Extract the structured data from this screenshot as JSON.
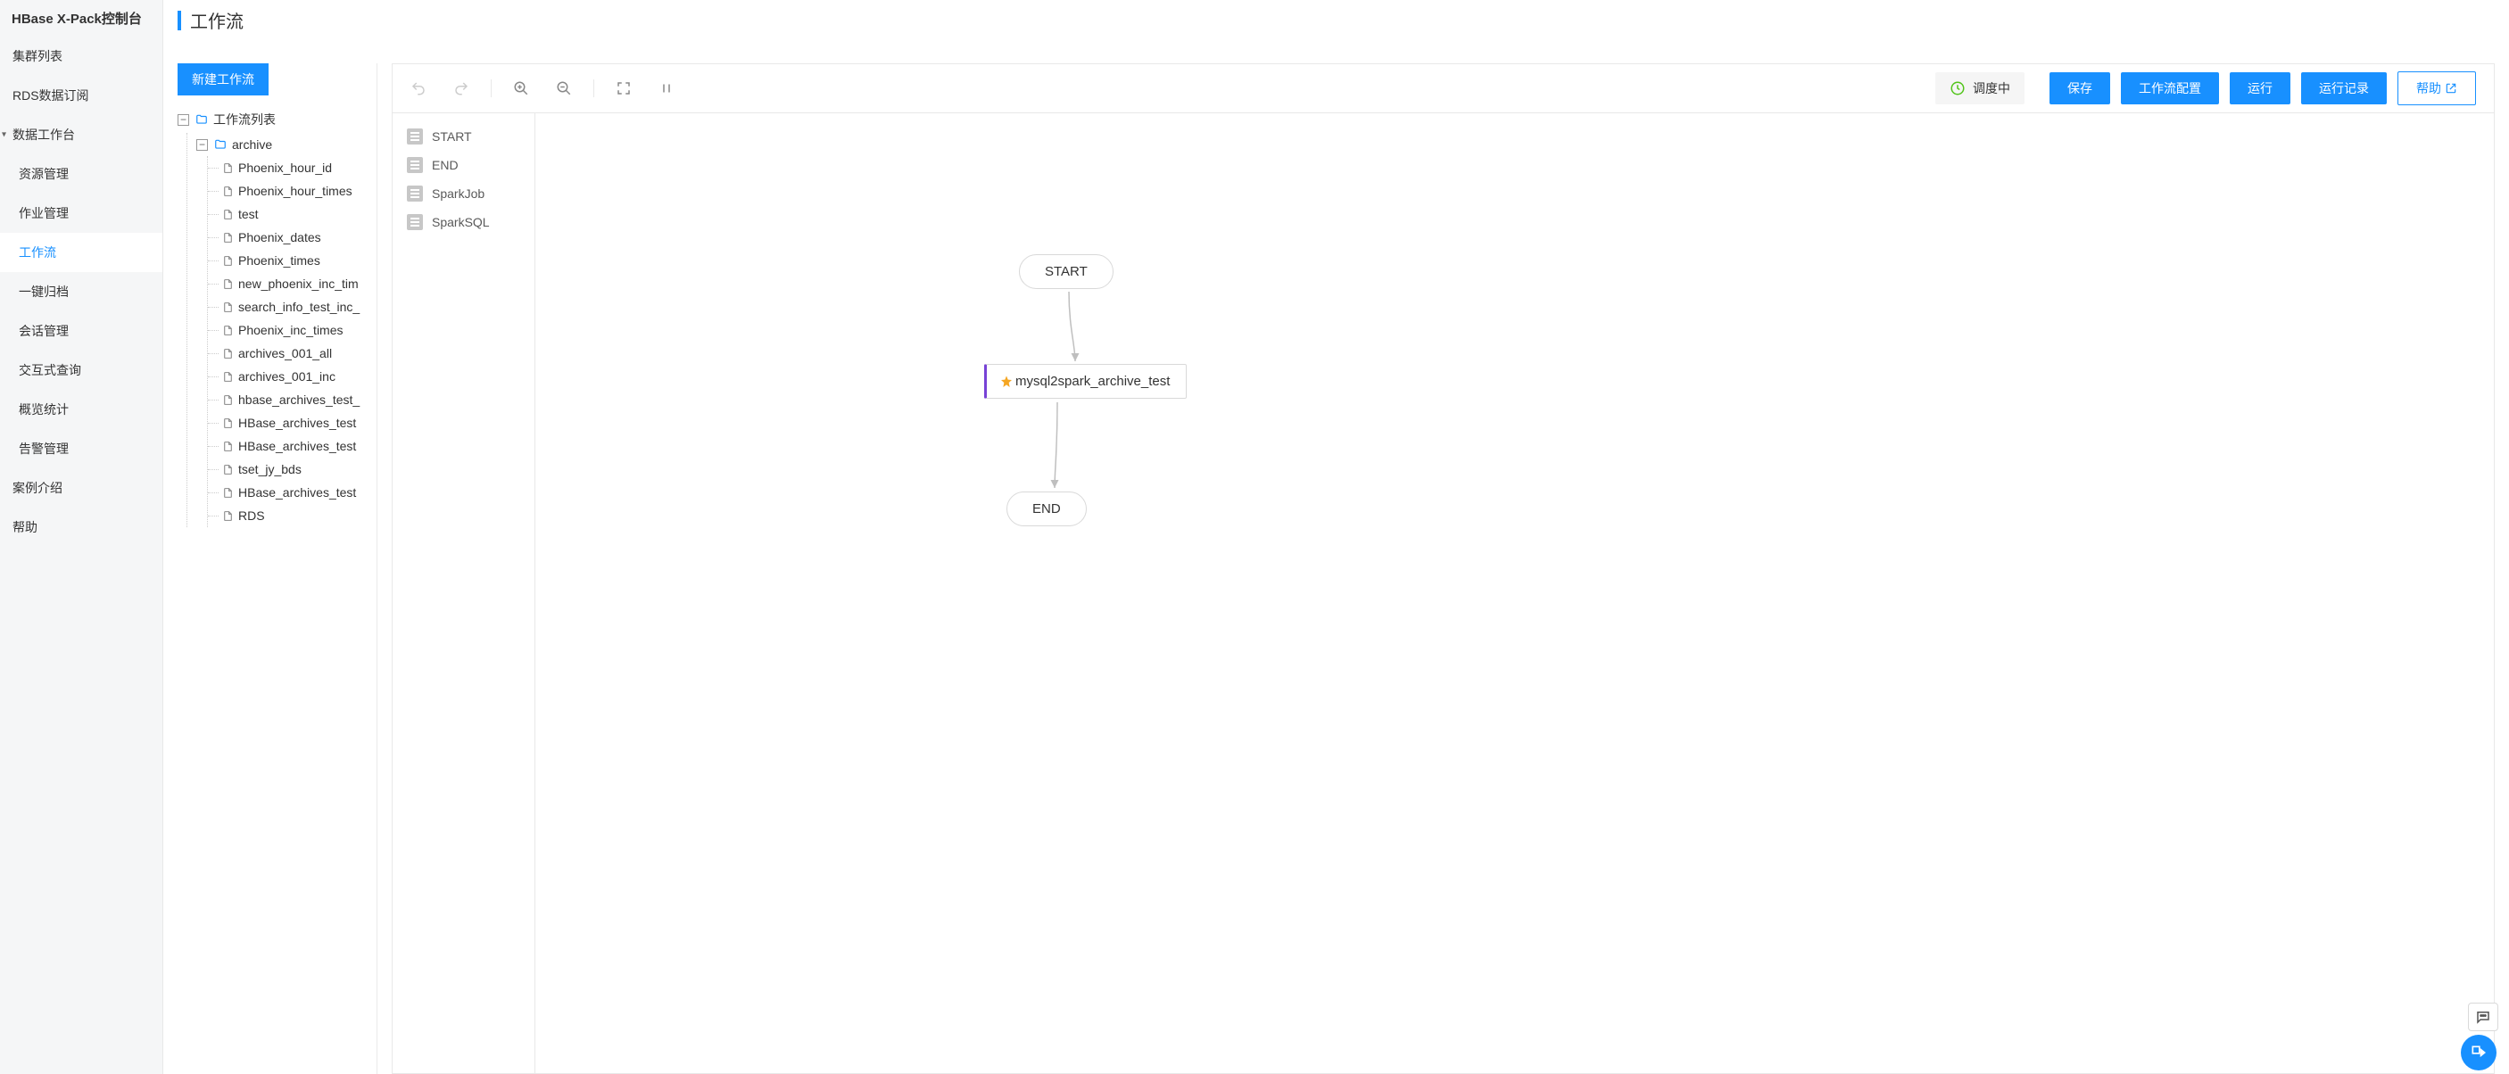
{
  "app_title": "HBase X-Pack控制台",
  "page_title": "工作流",
  "sidebar": {
    "items": [
      {
        "label": "集群列表",
        "type": "item"
      },
      {
        "label": "RDS数据订阅",
        "type": "item"
      },
      {
        "label": "数据工作台",
        "type": "section"
      },
      {
        "label": "资源管理",
        "type": "sub"
      },
      {
        "label": "作业管理",
        "type": "sub"
      },
      {
        "label": "工作流",
        "type": "sub",
        "active": true
      },
      {
        "label": "一键归档",
        "type": "sub"
      },
      {
        "label": "会话管理",
        "type": "sub"
      },
      {
        "label": "交互式查询",
        "type": "sub"
      },
      {
        "label": "概览统计",
        "type": "sub"
      },
      {
        "label": "告警管理",
        "type": "sub"
      },
      {
        "label": "案例介绍",
        "type": "item"
      },
      {
        "label": "帮助",
        "type": "item"
      }
    ]
  },
  "tree_panel": {
    "new_button": "新建工作流",
    "root": "工作流列表",
    "folder": "archive",
    "files": [
      "Phoenix_hour_id",
      "Phoenix_hour_times",
      "test",
      "Phoenix_dates",
      "Phoenix_times",
      "new_phoenix_inc_tim",
      "search_info_test_inc_",
      "Phoenix_inc_times",
      "archives_001_all",
      "archives_001_inc",
      "hbase_archives_test_",
      "HBase_archives_test",
      "HBase_archives_test",
      "tset_jy_bds",
      "HBase_archives_test",
      "RDS"
    ]
  },
  "toolbar": {
    "status_label": "调度中",
    "buttons": {
      "save": "保存",
      "config": "工作流配置",
      "run": "运行",
      "records": "运行记录",
      "help": "帮助"
    }
  },
  "palette": {
    "items": [
      "START",
      "END",
      "SparkJob",
      "SparkSQL"
    ]
  },
  "flow": {
    "start": "START",
    "task": "mysql2spark_archive_test",
    "end": "END"
  }
}
